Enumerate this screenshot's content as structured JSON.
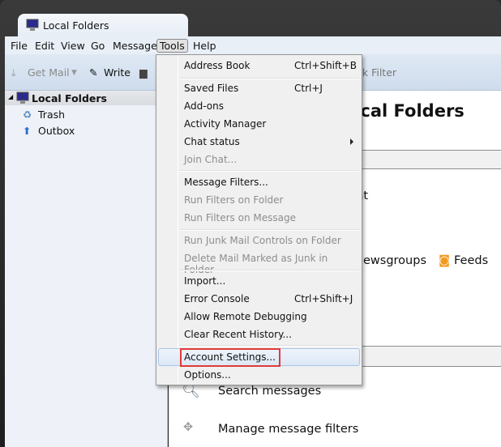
{
  "window": {
    "tab_title": "Local Folders"
  },
  "menubar": [
    {
      "label": "File"
    },
    {
      "label": "Edit"
    },
    {
      "label": "View"
    },
    {
      "label": "Go"
    },
    {
      "label": "Message"
    },
    {
      "label": "Tools"
    },
    {
      "label": "Help"
    }
  ],
  "toolbar": {
    "get_mail": "Get Mail",
    "write": "Write",
    "quick_filter_fragment": "ck Filter"
  },
  "sidebar": {
    "root": "Local Folders",
    "folders": [
      {
        "label": "Trash",
        "icon": "trash-icon"
      },
      {
        "label": "Outbox",
        "icon": "outbox-icon"
      }
    ]
  },
  "content": {
    "title_fragment": "ocal Folders",
    "account_fragment": "unt",
    "newsgroups_fragment": "ewsgroups",
    "feeds": "Feeds",
    "search": "Search messages",
    "filters": "Manage message filters"
  },
  "tools_menu": {
    "items": [
      {
        "label": "Address Book",
        "shortcut": "Ctrl+Shift+B",
        "enabled": true
      },
      {
        "label": "Saved Files",
        "shortcut": "Ctrl+J",
        "enabled": true
      },
      {
        "label": "Add-ons",
        "enabled": true
      },
      {
        "label": "Activity Manager",
        "enabled": true
      },
      {
        "label": "Chat status",
        "enabled": true,
        "submenu": true
      },
      {
        "label": "Join Chat...",
        "enabled": false
      },
      {
        "label": "Message Filters...",
        "enabled": true
      },
      {
        "label": "Run Filters on Folder",
        "enabled": false
      },
      {
        "label": "Run Filters on Message",
        "enabled": false
      },
      {
        "label": "Run Junk Mail Controls on Folder",
        "enabled": false
      },
      {
        "label": "Delete Mail Marked as Junk in Folder",
        "enabled": false
      },
      {
        "label": "Import...",
        "enabled": true
      },
      {
        "label": "Error Console",
        "shortcut": "Ctrl+Shift+J",
        "enabled": true
      },
      {
        "label": "Allow Remote Debugging",
        "enabled": true
      },
      {
        "label": "Clear Recent History...",
        "enabled": true
      },
      {
        "label": "Account Settings...",
        "enabled": true,
        "highlighted": true
      },
      {
        "label": "Options...",
        "enabled": true
      }
    ]
  },
  "colors": {
    "highlight_box": "#e23a3a",
    "feeds_icon": "#f29a1f"
  }
}
